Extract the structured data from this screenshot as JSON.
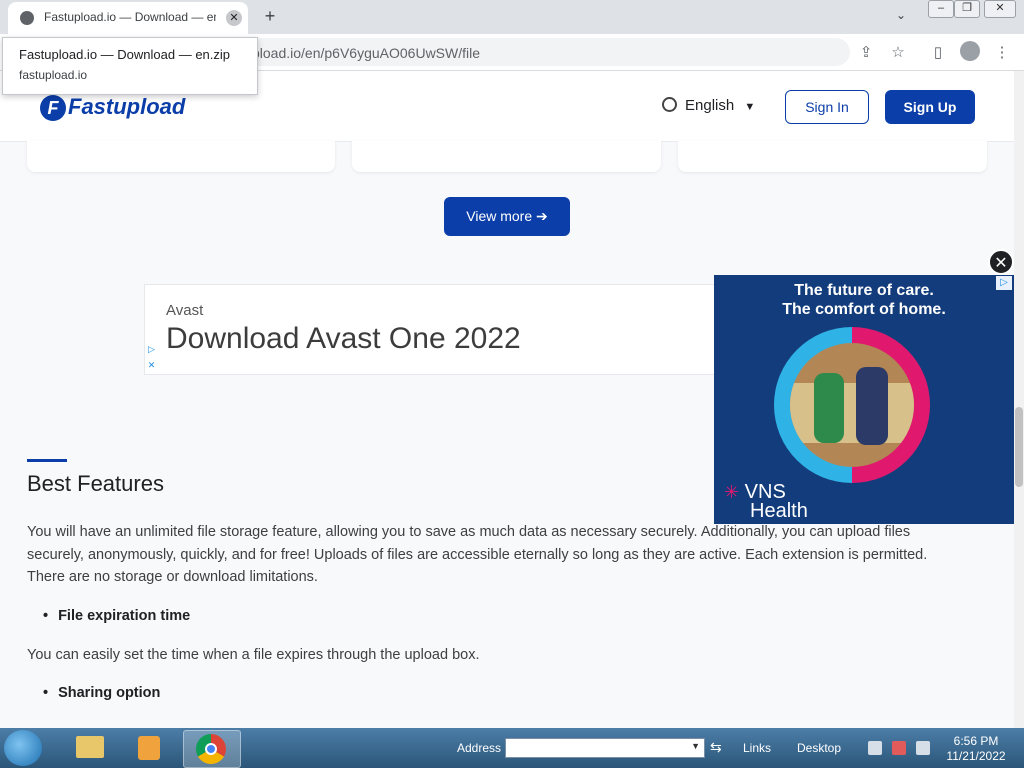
{
  "browser": {
    "tab_title": "Fastupload.io — Download — en.zip",
    "url": "pload.io/en/p6V6yguAO06UwSW/file",
    "tooltip_title": "Fastupload.io — Download — en.zip",
    "tooltip_host": "fastupload.io",
    "new_tab_symbol": "+",
    "close_symbol": "✕"
  },
  "site": {
    "logo_text": "Fastupload",
    "language": "English",
    "sign_in": "Sign In",
    "sign_up": "Sign Up",
    "view_more": "View more ➔"
  },
  "ad_inline": {
    "brand": "Avast",
    "headline": "Download Avast One 2022"
  },
  "ad_floating": {
    "line1": "The future of care.",
    "line2": "The comfort of home.",
    "logo_line1": "VNS",
    "logo_line2": "Health"
  },
  "features": {
    "title": "Best Features",
    "intro": "You will have an unlimited file storage feature, allowing you to save as much data as necessary securely. Additionally, you can upload files securely, anonymously, quickly, and for free! Uploads of files are accessible eternally so long as they are active. Each extension is permitted. There are no storage or download limitations.",
    "bullet1": "File expiration time",
    "bullet1_text": "You can easily set the time when a file expires through the upload box.",
    "bullet2": "Sharing option"
  },
  "taskbar": {
    "address_label": "Address",
    "links_label": "Links",
    "desktop_label": "Desktop",
    "time": "6:56 PM",
    "date": "11/21/2022"
  },
  "colors": {
    "brand_blue": "#0b3ea8",
    "ad_bg": "#123c7c"
  }
}
